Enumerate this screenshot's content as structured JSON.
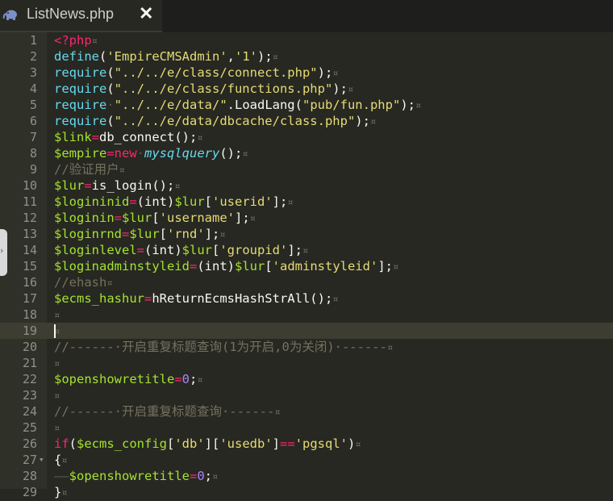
{
  "tab": {
    "title": "ListNews.php",
    "close": "✕",
    "icon": "php-elephant-icon"
  },
  "lines": [
    {
      "n": "1",
      "code": "<span class=\"k\">&lt;?php</span><span class=\"i\">¤</span>"
    },
    {
      "n": "2",
      "code": "<span class=\"f\">define</span>(<span class=\"s\">'EmpireCMSAdmin'</span>,<span class=\"s\">'1'</span>);<span class=\"i\">¤</span>"
    },
    {
      "n": "3",
      "code": "<span class=\"f\">require</span>(<span class=\"s\">\"../../e/class/connect.php\"</span>);<span class=\"i\">¤</span>"
    },
    {
      "n": "4",
      "code": "<span class=\"f\">require</span>(<span class=\"s\">\"../../e/class/functions.php\"</span>);<span class=\"i\">¤</span>"
    },
    {
      "n": "5",
      "code": "<span class=\"f\">require</span><span class=\"d\">·</span><span class=\"s\">\"../../e/data/\"</span>.LoadLang(<span class=\"s\">\"pub/fun.php\"</span>);<span class=\"i\">¤</span>"
    },
    {
      "n": "6",
      "code": "<span class=\"f\">require</span>(<span class=\"s\">\"../../e/data/dbcache/class.php\"</span>);<span class=\"i\">¤</span>"
    },
    {
      "n": "7",
      "code": "<span class=\"v\">$link</span><span class=\"k\">=</span>db_connect();<span class=\"i\">¤</span>"
    },
    {
      "n": "8",
      "code": "<span class=\"v\">$empire</span><span class=\"k\">=new</span><span class=\"d\">·</span><span class=\"fi\">mysqlquery</span>();<span class=\"i\">¤</span>"
    },
    {
      "n": "9",
      "code": "<span class=\"c\">//验证用户</span><span class=\"i\">¤</span>"
    },
    {
      "n": "10",
      "code": "<span class=\"v\">$lur</span><span class=\"k\">=</span>is_login();<span class=\"i\">¤</span>"
    },
    {
      "n": "11",
      "code": "<span class=\"v\">$logininid</span><span class=\"k\">=</span>(int)<span class=\"v\">$lur</span>[<span class=\"s\">'userid'</span>];<span class=\"i\">¤</span>"
    },
    {
      "n": "12",
      "code": "<span class=\"v\">$loginin</span><span class=\"k\">=</span><span class=\"v\">$lur</span>[<span class=\"s\">'username'</span>];<span class=\"i\">¤</span>"
    },
    {
      "n": "13",
      "code": "<span class=\"v\">$loginrnd</span><span class=\"k\">=</span><span class=\"v\">$lur</span>[<span class=\"s\">'rnd'</span>];<span class=\"i\">¤</span>"
    },
    {
      "n": "14",
      "code": "<span class=\"v\">$loginlevel</span><span class=\"k\">=</span>(int)<span class=\"v\">$lur</span>[<span class=\"s\">'groupid'</span>];<span class=\"i\">¤</span>"
    },
    {
      "n": "15",
      "code": "<span class=\"v\">$loginadminstyleid</span><span class=\"k\">=</span>(int)<span class=\"v\">$lur</span>[<span class=\"s\">'adminstyleid'</span>];<span class=\"i\">¤</span>"
    },
    {
      "n": "16",
      "code": "<span class=\"c\">//ehash</span><span class=\"i\">¤</span>"
    },
    {
      "n": "17",
      "code": "<span class=\"v\">$ecms_hashur</span><span class=\"k\">=</span>hReturnEcmsHashStrAll();<span class=\"i\">¤</span>"
    },
    {
      "n": "18",
      "code": "<span class=\"i\">¤</span>"
    },
    {
      "n": "19",
      "code": "<span class=\"i\">¤</span>"
    },
    {
      "n": "20",
      "code": "<span class=\"c\">//------·开启重复标题查询(1为开启,0为关闭)·------</span><span class=\"i\">¤</span>"
    },
    {
      "n": "21",
      "code": "<span class=\"i\">¤</span>"
    },
    {
      "n": "22",
      "code": "<span class=\"v\">$openshowretitle</span><span class=\"k\">=</span><span class=\"n\">0</span>;<span class=\"i\">¤</span>"
    },
    {
      "n": "23",
      "code": "<span class=\"i\">¤</span>"
    },
    {
      "n": "24",
      "code": "<span class=\"c\">//------·开启重复标题查询·------</span><span class=\"i\">¤</span>"
    },
    {
      "n": "25",
      "code": "<span class=\"i\">¤</span>"
    },
    {
      "n": "26",
      "code": "<span class=\"k\">if</span>(<span class=\"v\">$ecms_config</span>[<span class=\"s\">'db'</span>][<span class=\"s\">'usedb'</span>]<span class=\"k\">==</span><span class=\"s\">'pgsql'</span>)<span class=\"i\">¤</span>"
    },
    {
      "n": "27",
      "code": "{<span class=\"i\">¤</span>"
    },
    {
      "n": "28",
      "code": "<span class=\"d\">——</span><span class=\"v\">$openshowretitle</span><span class=\"k\">=</span><span class=\"n\">0</span>;<span class=\"i\">¤</span>"
    },
    {
      "n": "29",
      "code": "}<span class=\"i\">¤</span>"
    }
  ],
  "active_line": "19",
  "fold_line": "27",
  "fold_glyph": "▾"
}
